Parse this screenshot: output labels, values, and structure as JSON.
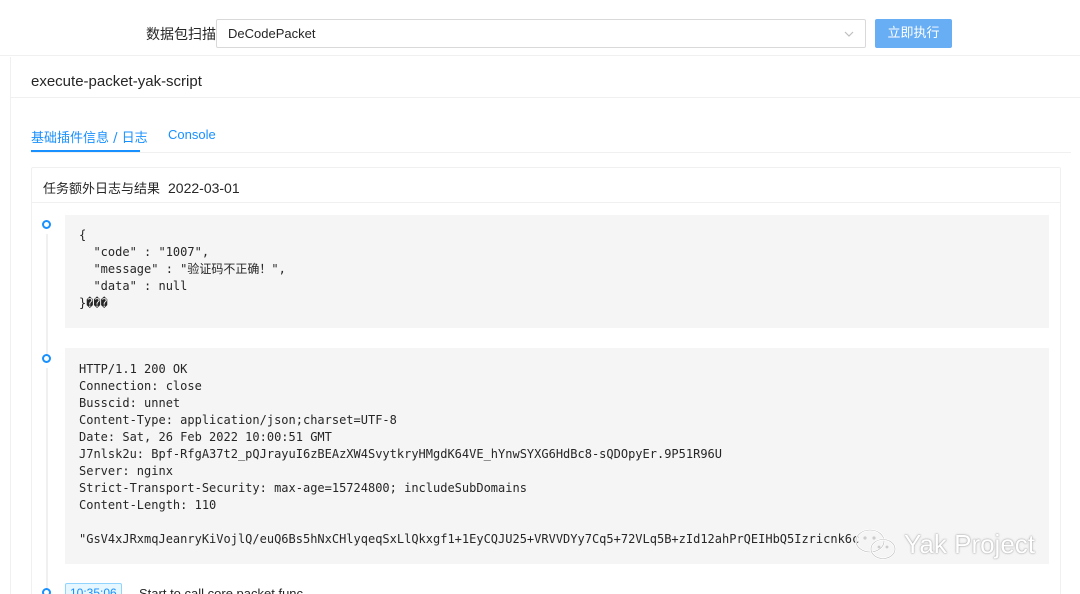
{
  "topbar": {
    "scan_label": "数据包扫描",
    "select_value": "DeCodePacket",
    "run_label": "立即执行"
  },
  "panel": {
    "title": "execute-packet-yak-script"
  },
  "tabs": [
    {
      "label": "基础插件信息 / 日志"
    },
    {
      "label": "Console"
    }
  ],
  "card": {
    "title": "任务额外日志与结果",
    "date": "2022-03-01"
  },
  "entries": [
    {
      "code": "{\n  \"code\" : \"1007\",\n  \"message\" : \"验证码不正确！\",\n  \"data\" : null\n}���"
    },
    {
      "code": "HTTP/1.1 200 OK\nConnection: close\nBusscid: unnet\nContent-Type: application/json;charset=UTF-8\nDate: Sat, 26 Feb 2022 10:00:51 GMT\nJ7nlsk2u: Bpf-RfgA37t2_pQJrayuI6zBEAzXW4SvytkryHMgdK64VE_hYnwSYXG6HdBc8-sQDOpyEr.9P51R96U\nServer: nginx\nStrict-Transport-Security: max-age=15724800; includeSubDomains\nContent-Length: 110\n\n\"GsV4xJRxmqJeanryKiVojlQ/euQ6Bs5hNxCHlyqeqSxLlQkxgf1+1EyCQJU25+VRVVDYy7Cq5+72VLq5B+zId12ahPrQEIHbQ5Izricnk6c"
    }
  ],
  "log": {
    "time": "10:35:06",
    "text": "Start to call core packet func"
  },
  "watermark": {
    "text": "Yak Project"
  },
  "colors": {
    "primary": "#1890ff",
    "button": "#68aef5",
    "code_bg": "#f5f5f5",
    "border": "#f0f0f0"
  }
}
